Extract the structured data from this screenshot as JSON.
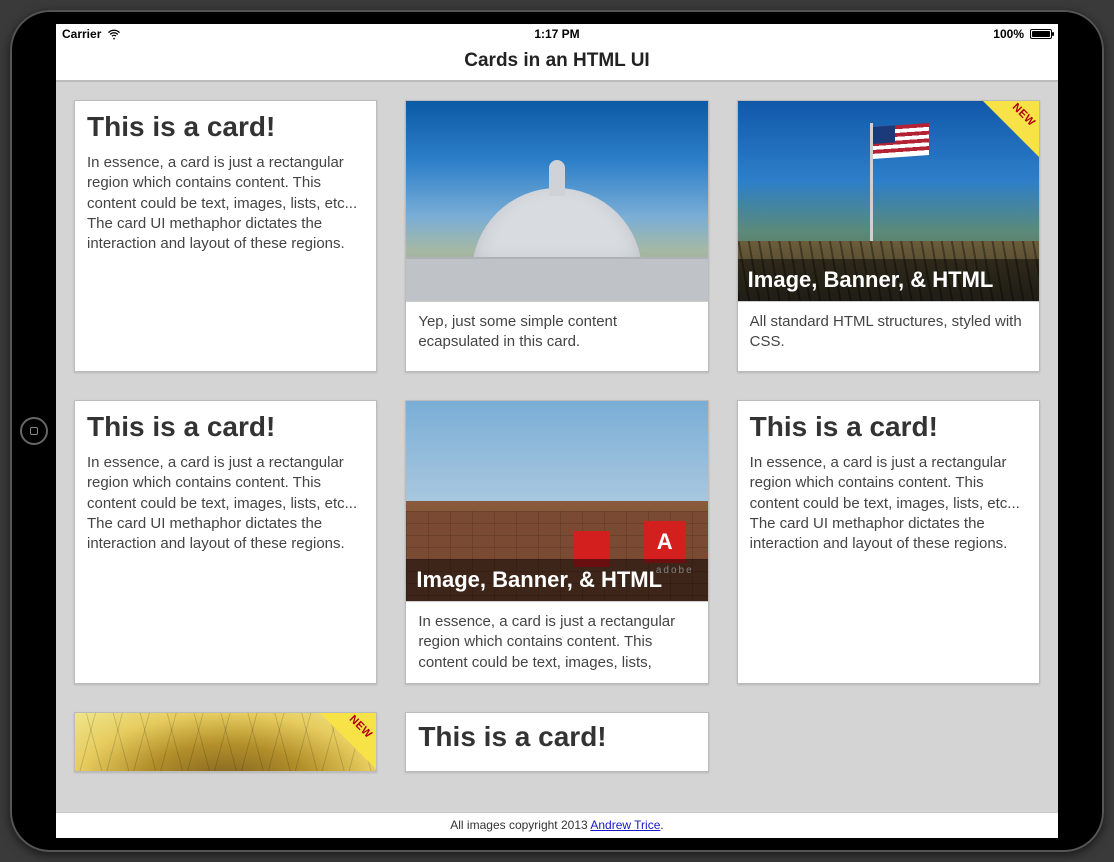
{
  "status_bar": {
    "carrier": "Carrier",
    "time": "1:17 PM",
    "battery_pct": "100%"
  },
  "app": {
    "title": "Cards in an HTML UI"
  },
  "cards": [
    {
      "title": "This is a card!",
      "body": "In essence, a card is just a rectangular region which contains content. This content could be text, images, lists, etc... The card UI methaphor dictates the interaction and layout of these regions."
    },
    {
      "body": "Yep, just some simple content ecapsulated in this card."
    },
    {
      "overlay_title": "Image, Banner, & HTML",
      "ribbon": "NEW",
      "body": "All standard HTML structures, styled with CSS."
    },
    {
      "title": "This is a card!",
      "body": "In essence, a card is just a rectangular region which contains content. This content could be text, images, lists, etc... The card UI methaphor dictates the interaction and layout of these regions."
    },
    {
      "overlay_title": "Image, Banner, & HTML",
      "body": "In essence, a card is just a rectangular region which contains content. This content could be text, images, lists,"
    },
    {
      "title": "This is a card!",
      "body": "In essence, a card is just a rectangular region which contains content. This content could be text, images, lists, etc... The card UI methaphor dictates the interaction and layout of these regions."
    },
    {
      "ribbon": "NEW"
    },
    {
      "title": "This is a card!"
    }
  ],
  "footer": {
    "prefix": "All images copyright 2013 ",
    "link_text": "Andrew Trice",
    "suffix": "."
  }
}
